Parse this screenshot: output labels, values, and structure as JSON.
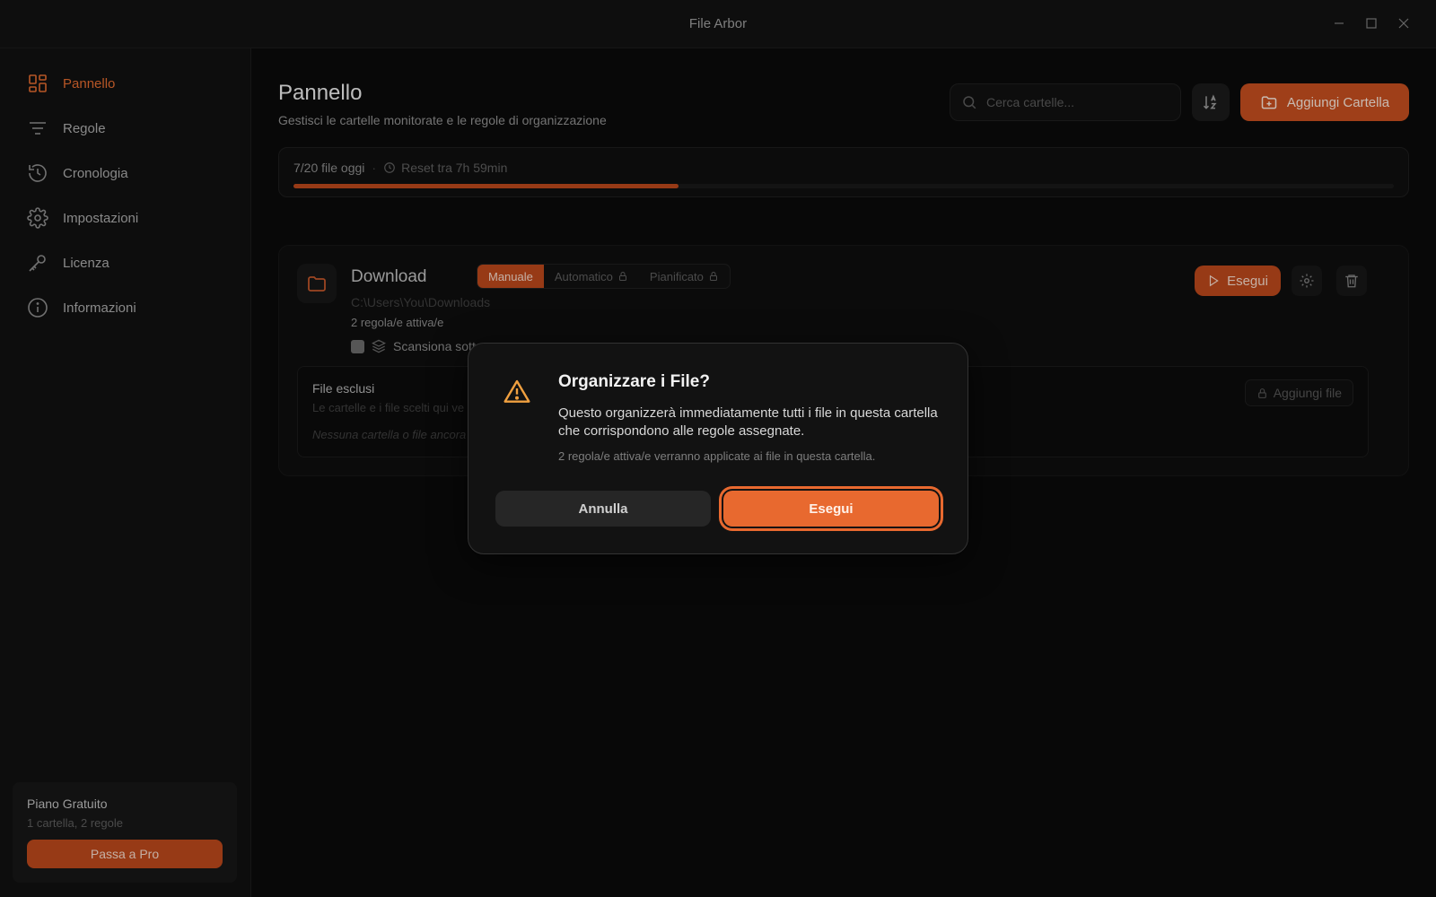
{
  "window": {
    "title": "File Arbor"
  },
  "sidebar": {
    "items": [
      {
        "label": "Pannello",
        "icon": "dashboard-icon",
        "active": true
      },
      {
        "label": "Regole",
        "icon": "filter-icon",
        "active": false
      },
      {
        "label": "Cronologia",
        "icon": "history-icon",
        "active": false
      },
      {
        "label": "Impostazioni",
        "icon": "gear-icon",
        "active": false
      },
      {
        "label": "Licenza",
        "icon": "key-icon",
        "active": false
      },
      {
        "label": "Informazioni",
        "icon": "info-icon",
        "active": false
      }
    ],
    "plan": {
      "title": "Piano Gratuito",
      "limits": "1 cartella, 2 regole",
      "upgrade_label": "Passa a Pro"
    }
  },
  "header": {
    "title": "Pannello",
    "subtitle": "Gestisci le cartelle monitorate e le regole di organizzazione",
    "search_placeholder": "Cerca cartelle...",
    "add_folder_label": "Aggiungi Cartella"
  },
  "usage": {
    "count_text": "7/20 file oggi",
    "separator": "·",
    "reset_text": "Reset tra 7h 59min",
    "progress_fraction": 0.35
  },
  "folder": {
    "name": "Download",
    "modes": [
      {
        "label": "Manuale",
        "active": true,
        "locked": false
      },
      {
        "label": "Automatico",
        "active": false,
        "locked": true
      },
      {
        "label": "Pianificato",
        "active": false,
        "locked": true
      }
    ],
    "path": "C:\\Users\\You\\Downloads",
    "rules_text": "2 regola/e attiva/e",
    "scan_label": "Scansiona sott",
    "run_label": "Esegui",
    "excluded": {
      "title": "File esclusi",
      "description": "Le cartelle e i file scelti qui ve",
      "empty_text": "Nessuna cartella o file ancora",
      "add_file_label": "Aggiungi file"
    }
  },
  "dialog": {
    "title": "Organizzare i File?",
    "body": "Questo organizzerà immediatamente tutti i file in questa cartella che corrispondono alle regole assegnate.",
    "note": "2 regola/e attiva/e verranno applicate ai file in questa cartella.",
    "cancel_label": "Annulla",
    "confirm_label": "Esegui"
  },
  "colors": {
    "accent": "#e8692f",
    "accent_dark": "#b9471b",
    "warning": "#f0a040",
    "background": "#0b0b0b"
  }
}
